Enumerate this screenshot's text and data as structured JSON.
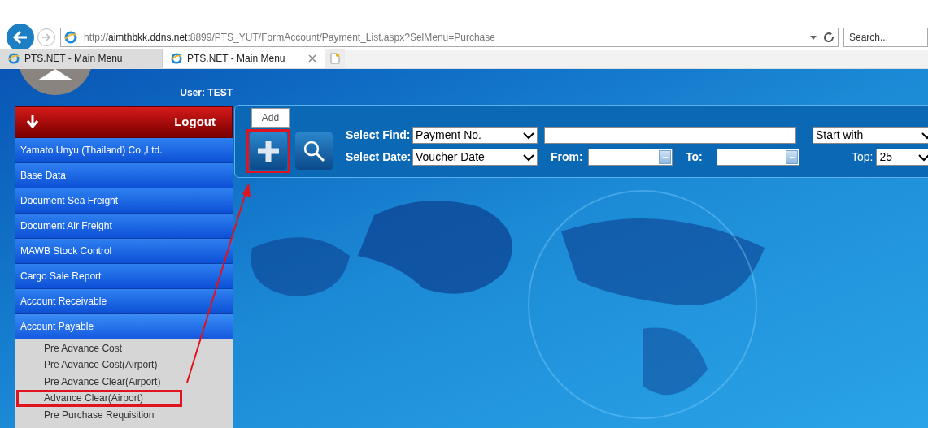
{
  "browser": {
    "address": {
      "scheme": "http://",
      "host": "aimthbkk.ddns.net",
      "path": ":8899/PTS_YUT/FormAccount/Payment_List.aspx?SelMenu=Purchase"
    },
    "search": {
      "placeholder": "Search..."
    },
    "tabs": [
      {
        "label": "PTS.NET - Main Menu",
        "selected": false
      },
      {
        "label": "PTS.NET - Main Menu",
        "selected": true
      }
    ]
  },
  "sidebar": {
    "user": "User: TEST",
    "logout": "Logout",
    "items": [
      {
        "label": "Yamato Unyu (Thailand) Co.,Ltd.",
        "expanded": false
      },
      {
        "label": "Base Data",
        "expanded": false
      },
      {
        "label": "Document Sea Freight",
        "expanded": false
      },
      {
        "label": "Document Air Freight",
        "expanded": false
      },
      {
        "label": "MAWB Stock Control",
        "expanded": false
      },
      {
        "label": "Cargo Sale Report",
        "expanded": false
      },
      {
        "label": "Account Receivable",
        "expanded": false
      },
      {
        "label": "Account Payable",
        "expanded": true,
        "children": [
          {
            "label": "Pre Advance Cost",
            "highlighted": false
          },
          {
            "label": "Pre Advance Cost(Airport)",
            "highlighted": false
          },
          {
            "label": "Pre Advance Clear(Airport)",
            "highlighted": false
          },
          {
            "label": "Advance Clear(Airport)",
            "highlighted": true
          },
          {
            "label": "Pre Purchase Requisition",
            "highlighted": false
          }
        ]
      }
    ]
  },
  "toolbar": {
    "add_tooltip": "Add",
    "add_highlighted": true,
    "select_find": {
      "label": "Select Find:",
      "value": "Payment No."
    },
    "match": {
      "value": "Start with"
    },
    "select_date": {
      "label": "Select Date:",
      "value": "Voucher Date"
    },
    "from": {
      "label": "From:"
    },
    "to": {
      "label": "To:"
    },
    "top": {
      "label": "Top:",
      "value": "25"
    }
  }
}
